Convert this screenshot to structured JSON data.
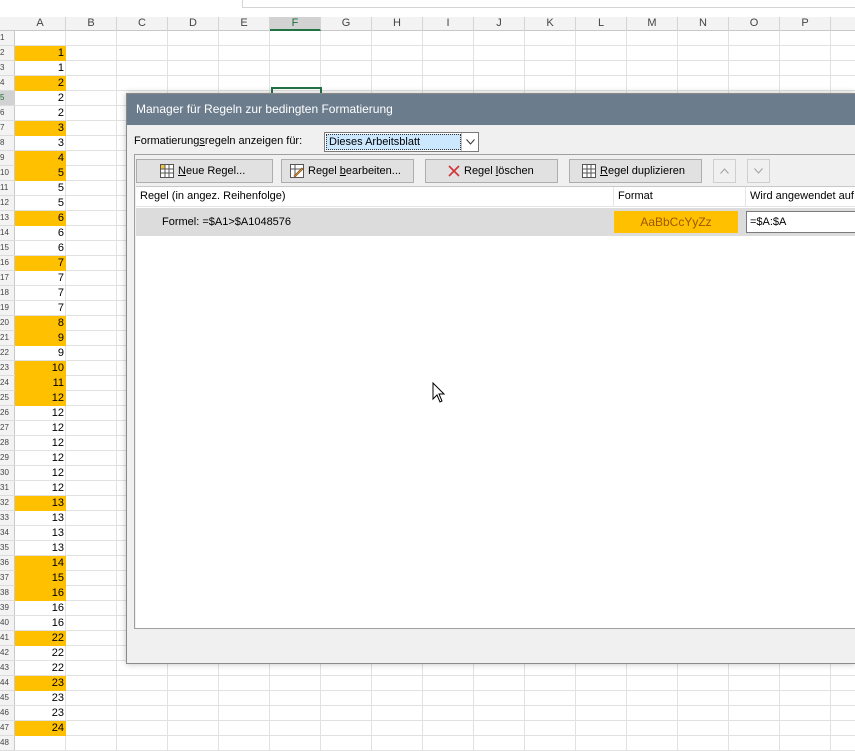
{
  "sheet": {
    "columns": [
      "A",
      "B",
      "C",
      "D",
      "E",
      "F",
      "G",
      "H",
      "I",
      "J",
      "K",
      "L",
      "M",
      "N",
      "O",
      "P"
    ],
    "active_column": "F",
    "active_row": "5",
    "rows": [
      {
        "num": "1",
        "value": "",
        "hl": false
      },
      {
        "num": "2",
        "value": "1",
        "hl": true
      },
      {
        "num": "3",
        "value": "1",
        "hl": false
      },
      {
        "num": "4",
        "value": "2",
        "hl": true
      },
      {
        "num": "5",
        "value": "2",
        "hl": false
      },
      {
        "num": "6",
        "value": "2",
        "hl": false
      },
      {
        "num": "7",
        "value": "3",
        "hl": true
      },
      {
        "num": "8",
        "value": "3",
        "hl": false
      },
      {
        "num": "9",
        "value": "4",
        "hl": true
      },
      {
        "num": "10",
        "value": "5",
        "hl": true
      },
      {
        "num": "11",
        "value": "5",
        "hl": false
      },
      {
        "num": "12",
        "value": "5",
        "hl": false
      },
      {
        "num": "13",
        "value": "6",
        "hl": true
      },
      {
        "num": "14",
        "value": "6",
        "hl": false
      },
      {
        "num": "15",
        "value": "6",
        "hl": false
      },
      {
        "num": "16",
        "value": "7",
        "hl": true
      },
      {
        "num": "17",
        "value": "7",
        "hl": false
      },
      {
        "num": "18",
        "value": "7",
        "hl": false
      },
      {
        "num": "19",
        "value": "7",
        "hl": false
      },
      {
        "num": "20",
        "value": "8",
        "hl": true
      },
      {
        "num": "21",
        "value": "9",
        "hl": true
      },
      {
        "num": "22",
        "value": "9",
        "hl": false
      },
      {
        "num": "23",
        "value": "10",
        "hl": true
      },
      {
        "num": "24",
        "value": "11",
        "hl": true
      },
      {
        "num": "25",
        "value": "12",
        "hl": true
      },
      {
        "num": "26",
        "value": "12",
        "hl": false
      },
      {
        "num": "27",
        "value": "12",
        "hl": false
      },
      {
        "num": "28",
        "value": "12",
        "hl": false
      },
      {
        "num": "29",
        "value": "12",
        "hl": false
      },
      {
        "num": "30",
        "value": "12",
        "hl": false
      },
      {
        "num": "31",
        "value": "12",
        "hl": false
      },
      {
        "num": "32",
        "value": "13",
        "hl": true
      },
      {
        "num": "33",
        "value": "13",
        "hl": false
      },
      {
        "num": "34",
        "value": "13",
        "hl": false
      },
      {
        "num": "35",
        "value": "13",
        "hl": false
      },
      {
        "num": "36",
        "value": "14",
        "hl": true
      },
      {
        "num": "37",
        "value": "15",
        "hl": true
      },
      {
        "num": "38",
        "value": "16",
        "hl": true
      },
      {
        "num": "39",
        "value": "16",
        "hl": false
      },
      {
        "num": "40",
        "value": "16",
        "hl": false
      },
      {
        "num": "41",
        "value": "22",
        "hl": true
      },
      {
        "num": "42",
        "value": "22",
        "hl": false
      },
      {
        "num": "43",
        "value": "22",
        "hl": false
      },
      {
        "num": "44",
        "value": "23",
        "hl": true
      },
      {
        "num": "45",
        "value": "23",
        "hl": false
      },
      {
        "num": "46",
        "value": "23",
        "hl": false
      },
      {
        "num": "47",
        "value": "24",
        "hl": true
      },
      {
        "num": "48",
        "value": "",
        "hl": false
      }
    ],
    "highlight_color": "#ffc000"
  },
  "dialog": {
    "title": "Manager für Regeln zur bedingten Formatierung",
    "show_label_pre": "Formatierung",
    "show_label_accel": "s",
    "show_label_post": "regeln anzeigen für:",
    "show_value": "Dieses Arbeitsblatt",
    "buttons": {
      "new_accel": "N",
      "new_rest": "eue Regel...",
      "edit_pre": "Regel ",
      "edit_accel": "b",
      "edit_rest": "earbeiten...",
      "delete_pre": "Regel ",
      "delete_accel": "l",
      "delete_rest": "öschen",
      "duplicate_pre": "",
      "duplicate_accel": "R",
      "duplicate_rest": "egel duplizieren"
    },
    "columns": {
      "rule": "Regel (in angez. Reihenfolge)",
      "format": "Format",
      "applies": "Wird angewendet auf"
    },
    "rule": {
      "formula": "Formel: =$A1>$A1048576",
      "preview": "AaBbCcYyZz",
      "applies_to": "=$A:$A"
    }
  }
}
